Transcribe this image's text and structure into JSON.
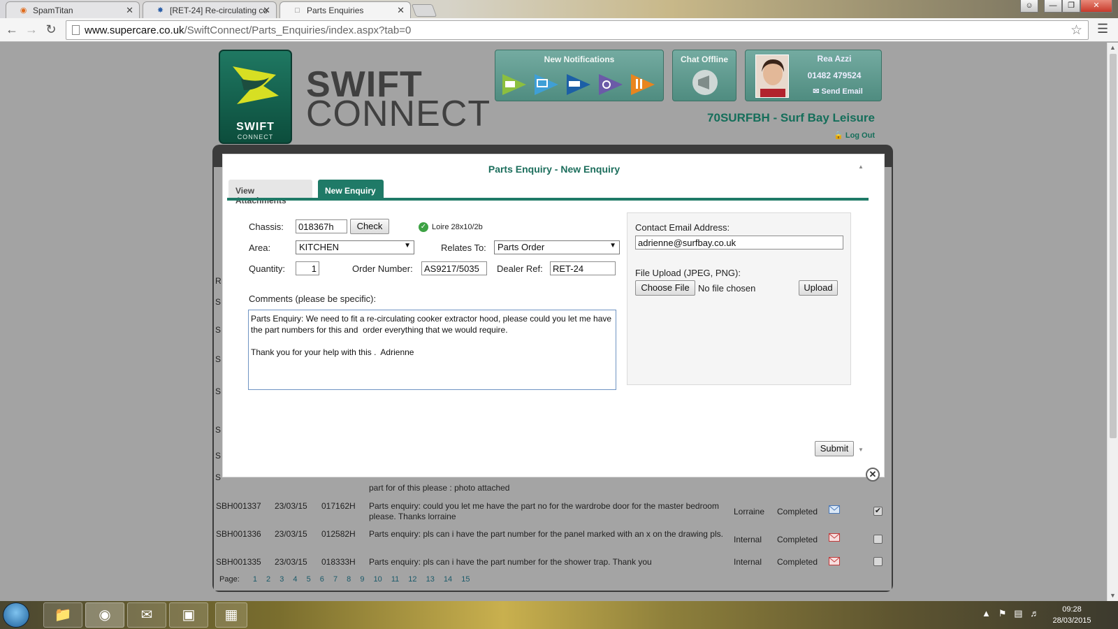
{
  "browser": {
    "tabs": [
      {
        "title": "SpamTitan",
        "icon": "spamtitan-icon"
      },
      {
        "title": "[RET-24] Re-circulating co",
        "icon": "jira-icon"
      },
      {
        "title": "Parts Enquiries",
        "icon": "page-icon"
      }
    ],
    "url_host": "www.supercare.co.uk",
    "url_path": "/SwiftConnect/Parts_Enquiries/index.aspx?tab=0"
  },
  "header": {
    "logo_word": "SWIFT",
    "logo_sub": "CONNECT",
    "brand_line1": "SWIFT",
    "brand_line2": "CONNECT",
    "notifications_title": "New Notifications",
    "chat_title": "Chat Offline",
    "user_name": "Rea Azzi",
    "user_phone": "01482 479524",
    "send_email": "Send Email",
    "dealer": "70SURFBH - Surf Bay Leisure",
    "logout": "Log Out"
  },
  "modal": {
    "title": "Parts Enquiry - New Enquiry",
    "tabs": {
      "attachments": "View Attachments",
      "new_enquiry": "New Enquiry"
    },
    "chassis_label": "Chassis:",
    "chassis_value": "018367h",
    "check_button": "Check",
    "model_text": "Loire 28x10/2b",
    "area_label": "Area:",
    "area_value": "KITCHEN",
    "relates_label": "Relates To:",
    "relates_value": "Parts Order",
    "quantity_label": "Quantity:",
    "quantity_value": "1",
    "order_label": "Order Number:",
    "order_value": "AS9217/5035",
    "dealer_ref_label": "Dealer Ref:",
    "dealer_ref_value": "RET-24",
    "comments_label": "Comments (please be specific):",
    "comments_value": "Parts Enquiry: We need to fit a re-circulating cooker extractor hood, please could you let me have the part numbers for this and  order everything that we would require.\n\nThank you for your help with this .  Adrienne",
    "email_label": "Contact Email Address:",
    "email_value": "adrienne@surfbay.co.uk",
    "upload_label": "File Upload (JPEG, PNG):",
    "choose_file": "Choose File",
    "no_file": "No file chosen",
    "upload_button": "Upload",
    "submit_button": "Submit"
  },
  "table": {
    "partial_text": "part for of this please : photo attached",
    "rows": [
      {
        "ref": "SBH001337",
        "date": "23/03/15",
        "chassis": "017162H",
        "desc": "Parts enquiry: could you let me have the part no for the wardrobe door for the master bedroom please. Thanks lorraine",
        "user": "Lorraine",
        "status": "Completed",
        "checked": true
      },
      {
        "ref": "SBH001336",
        "date": "23/03/15",
        "chassis": "012582H",
        "desc": "Parts enquiry: pls can i have the part number for the panel marked with an x on the drawing pls.",
        "user": "Internal",
        "status": "Completed",
        "checked": false
      },
      {
        "ref": "SBH001335",
        "date": "23/03/15",
        "chassis": "018333H",
        "desc": "Parts enquiry: pls can i have the part number for the shower trap. Thank you",
        "user": "Internal",
        "status": "Completed",
        "checked": false
      }
    ],
    "page_label": "Page:",
    "pages": [
      "1",
      "2",
      "3",
      "4",
      "5",
      "6",
      "7",
      "8",
      "9",
      "10",
      "11",
      "12",
      "13",
      "14",
      "15"
    ]
  },
  "taskbar": {
    "time": "09:28",
    "date": "28/03/2015",
    "apps": [
      "explorer-icon",
      "chrome-icon",
      "outlook-icon",
      "photos-icon",
      "sage-icon"
    ]
  },
  "colors": {
    "accent": "#1f7a67",
    "panel": "#5f9b8f",
    "title": "#1c6e5c"
  }
}
